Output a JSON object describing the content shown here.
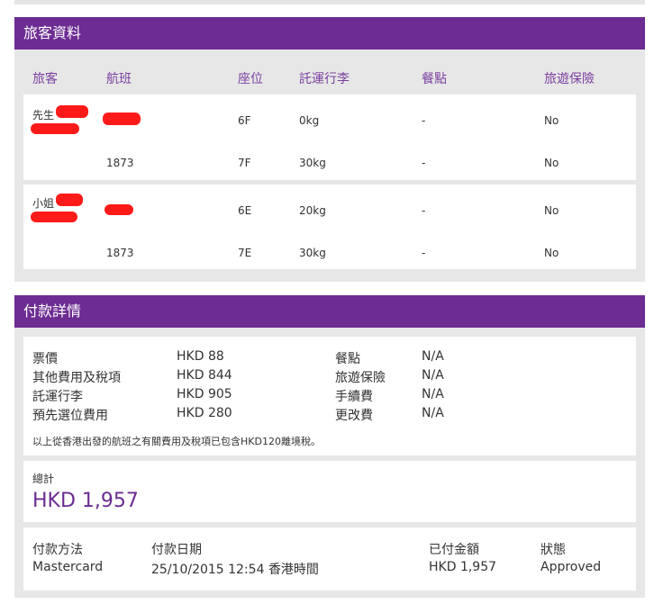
{
  "passenger_section": {
    "title": "旅客資料",
    "headers": [
      "旅客",
      "航班",
      "座位",
      "託運行李",
      "餐點",
      "旅遊保險"
    ],
    "passengers": [
      {
        "title": "先生",
        "rows": [
          {
            "flight": "",
            "seat": "6F",
            "baggage": "0kg",
            "meal": "-",
            "insurance": "No"
          },
          {
            "flight": "1873",
            "seat": "7F",
            "baggage": "30kg",
            "meal": "-",
            "insurance": "No"
          }
        ]
      },
      {
        "title": "小姐",
        "rows": [
          {
            "flight": "",
            "seat": "6E",
            "baggage": "20kg",
            "meal": "-",
            "insurance": "No"
          },
          {
            "flight": "1873",
            "seat": "7E",
            "baggage": "30kg",
            "meal": "-",
            "insurance": "No"
          }
        ]
      }
    ]
  },
  "payment_section": {
    "title": "付款詳情",
    "fees_left": [
      {
        "label": "票價",
        "value": "HKD 88"
      },
      {
        "label": "其他費用及稅項",
        "value": "HKD 844"
      },
      {
        "label": "託運行李",
        "value": "HKD 905"
      },
      {
        "label": "預先選位費用",
        "value": "HKD 280"
      }
    ],
    "fees_right": [
      {
        "label": "餐點",
        "value": "N/A"
      },
      {
        "label": "旅遊保險",
        "value": "N/A"
      },
      {
        "label": "手續費",
        "value": "N/A"
      },
      {
        "label": "更改費",
        "value": "N/A"
      }
    ],
    "note": "以上從香港出發的航班之有關費用及稅項已包含HKD120離境稅。",
    "total_label": "總計",
    "total_value": "HKD 1,957",
    "details_headers": {
      "method": "付款方法",
      "date": "付款日期",
      "paid": "已付金額",
      "status": "狀態"
    },
    "details_values": {
      "method": "Mastercard",
      "date": "25/10/2015 12:54 香港時間",
      "paid": "HKD 1,957",
      "status": "Approved"
    }
  },
  "colors": {
    "header_bg": "#6c2c92",
    "accent_text": "#7b3fa0",
    "panel_bg": "#e7e7e7",
    "redaction": "#ff1a1a"
  }
}
